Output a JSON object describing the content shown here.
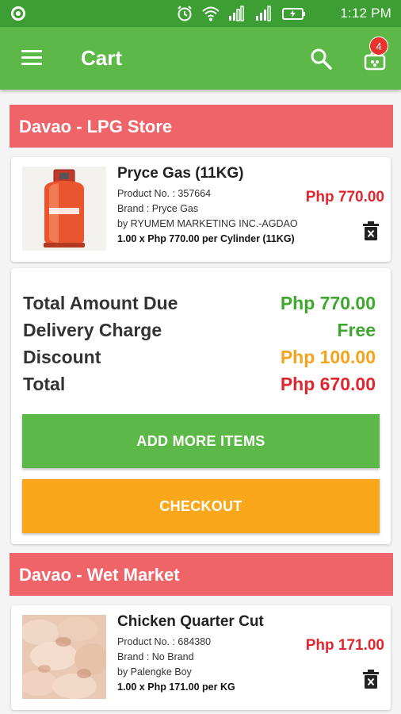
{
  "status_bar": {
    "time": "1:12 PM"
  },
  "toolbar": {
    "title": "Cart",
    "cart_count": "4"
  },
  "colors": {
    "toolbar": "#5cb947",
    "status_bar": "#3d9e33",
    "store_header": "#ef6468",
    "price_red": "#e0262e",
    "total_green": "#3ea82e",
    "discount_orange": "#f7a21b",
    "add_more_button": "#5cb947",
    "checkout_button": "#fba71b"
  },
  "stores": [
    {
      "name": "Davao - LPG Store",
      "items": [
        {
          "name": "Pryce Gas (11KG)",
          "product_no": "Product No. : 357664",
          "brand": "Brand : Pryce Gas",
          "seller": "by RYUMEM MARKETING INC.-AGDAO",
          "quantity_line": "1.00 x Php 770.00 per Cylinder (11KG)",
          "price": "Php 770.00",
          "image_icon": "lpg-cylinder-image"
        }
      ],
      "summary": {
        "total_amount_due_label": "Total Amount Due",
        "total_amount_due": "Php 770.00",
        "delivery_charge_label": "Delivery Charge",
        "delivery_charge": "Free",
        "discount_label": "Discount",
        "discount": "Php 100.00",
        "total_label": "Total",
        "total": "Php 670.00"
      },
      "add_more_label": "ADD MORE ITEMS",
      "checkout_label": "CHECKOUT"
    },
    {
      "name": "Davao - Wet Market",
      "items": [
        {
          "name": "Chicken Quarter Cut",
          "product_no": "Product No. : 684380",
          "brand": "Brand : No Brand",
          "seller": "by Palengke Boy",
          "quantity_line": "1.00 x Php 171.00 per KG",
          "price": "Php 171.00",
          "image_icon": "chicken-image"
        }
      ]
    }
  ]
}
